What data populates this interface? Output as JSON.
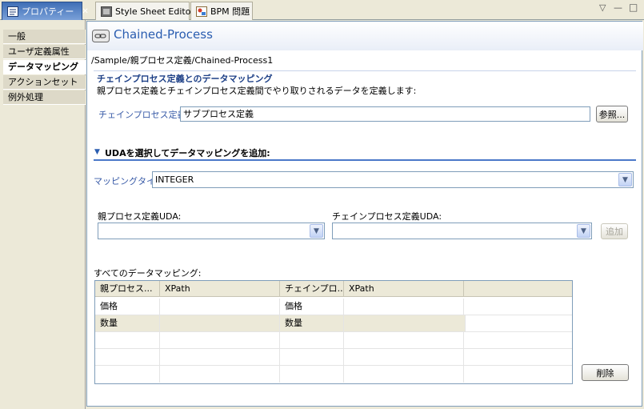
{
  "tabs": [
    {
      "label": "プロパティー",
      "close": "✕"
    },
    {
      "label": "Style Sheet Editor"
    },
    {
      "label": "BPM 問題"
    }
  ],
  "window_controls": {
    "menu": "▽",
    "minimize": "—",
    "maximize": "□"
  },
  "nav": {
    "items": [
      "一般",
      "ユーザ定義属性",
      "データマッピング",
      "アクションセット",
      "例外処理"
    ],
    "selected": "データマッピング"
  },
  "header": {
    "title": "Chained-Process",
    "path": "/Sample/親プロセス定義/Chained-Process1"
  },
  "section1": {
    "title": "チェインプロセス定義とのデータマッピング",
    "description": "親プロセス定義とチェインプロセス定義間でやり取りされるデータを定義します:",
    "chain_label": "チェインプロセス定義:",
    "chain_value": "サブプロセス定義",
    "browse_label": "参照..."
  },
  "section2": {
    "title": "UDAを選択してデータマッピングを追加:",
    "mapping_type_label": "マッピングタイプ",
    "mapping_type_value": "INTEGER",
    "parent_uda_label": "親プロセス定義UDA:",
    "chain_uda_label": "チェインプロセス定義UDA:",
    "add_label": "追加"
  },
  "all_mappings": {
    "label": "すべてのデータマッピング:",
    "columns": [
      "親プロセス...",
      "XPath",
      "チェインプロ...",
      "XPath",
      ""
    ],
    "rows": [
      [
        "価格",
        "",
        "価格",
        "",
        ""
      ],
      [
        "数量",
        "",
        "数量",
        "",
        ""
      ],
      [
        "",
        "",
        "",
        "",
        ""
      ],
      [
        "",
        "",
        "",
        "",
        ""
      ],
      [
        "",
        "",
        "",
        "",
        ""
      ]
    ],
    "delete_label": "削除"
  },
  "colors": {
    "accent": "#2a5db0",
    "section_line": "#4b78c9",
    "panel": "#ece9d8"
  }
}
